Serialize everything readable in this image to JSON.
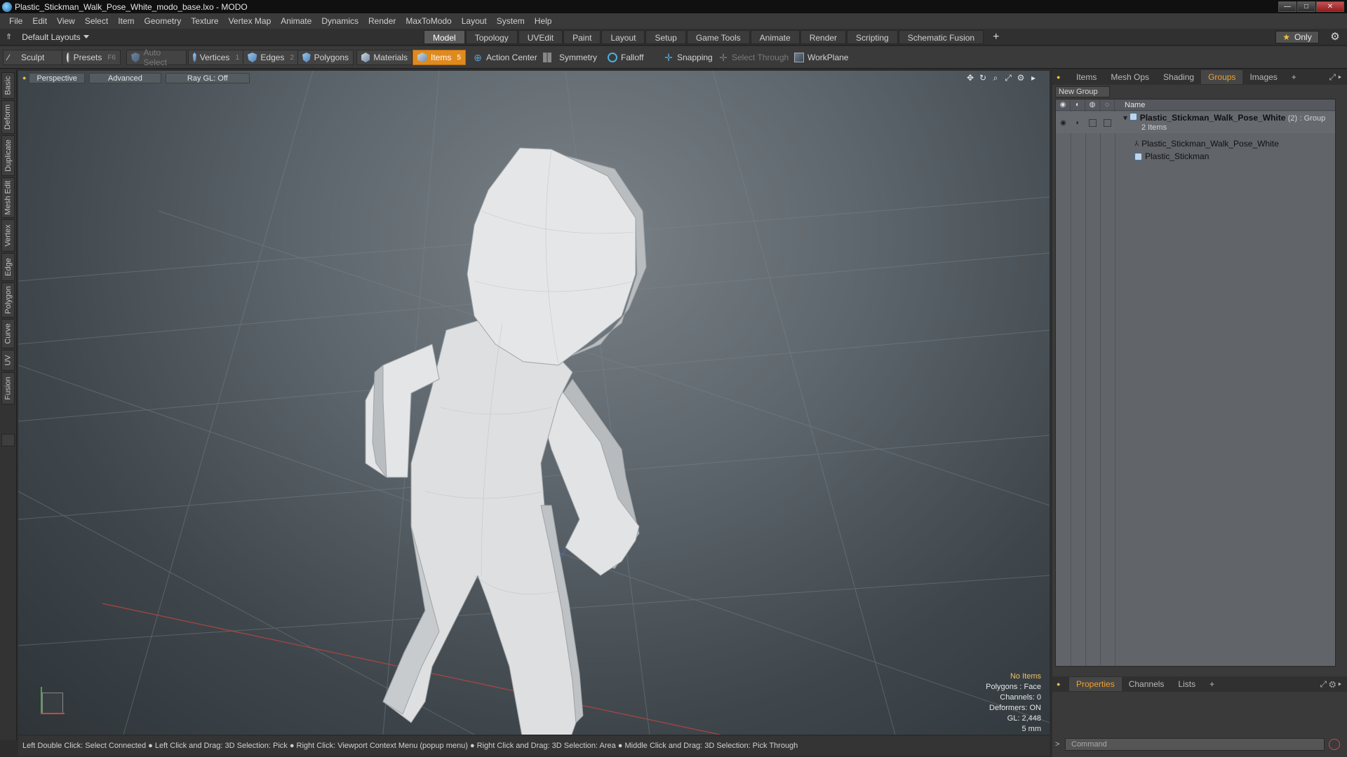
{
  "window": {
    "title": "Plastic_Stickman_Walk_Pose_White_modo_base.lxo - MODO",
    "controls": {
      "minimize": "—",
      "maximize": "□",
      "close": "✕"
    }
  },
  "menu": [
    "File",
    "Edit",
    "View",
    "Select",
    "Item",
    "Geometry",
    "Texture",
    "Vertex Map",
    "Animate",
    "Dynamics",
    "Render",
    "MaxToModo",
    "Layout",
    "System",
    "Help"
  ],
  "layoutbar": {
    "layout": "Default Layouts",
    "tabs": [
      "Model",
      "Topology",
      "UVEdit",
      "Paint",
      "Layout",
      "Setup",
      "Game Tools",
      "Animate",
      "Render",
      "Scripting",
      "Schematic Fusion"
    ],
    "active_tab": "Model",
    "add": "+",
    "only_label": "Only"
  },
  "toolbar": {
    "sculpt": "Sculpt",
    "presets": "Presets",
    "presets_key": "F6",
    "auto_select": "Auto Select",
    "vertices": "Vertices",
    "vertices_count": "1",
    "edges": "Edges",
    "edges_count": "2",
    "polygons": "Polygons",
    "materials": "Materials",
    "items": "Items",
    "items_count": "5",
    "action_center": "Action Center",
    "symmetry": "Symmetry",
    "falloff": "Falloff",
    "snapping": "Snapping",
    "select_through": "Select Through",
    "workplane": "WorkPlane"
  },
  "left_tabs": [
    "Basic",
    "Deform",
    "Duplicate",
    "Mesh Edit",
    "Vertex",
    "Edge",
    "Polygon",
    "Curve",
    "UV",
    "Fusion"
  ],
  "viewport": {
    "view": "Perspective",
    "mode": "Advanced",
    "raygl": "Ray GL: Off",
    "stats": {
      "items": "No Items",
      "polygons": "Polygons : Face",
      "channels": "Channels: 0",
      "deformers": "Deformers: ON",
      "gl": "GL: 2,448",
      "scale": "5 mm"
    }
  },
  "hint": "Left Double Click: Select Connected ● Left Click and Drag: 3D Selection: Pick ● Right Click: Viewport Context Menu (popup menu) ● Right Click and Drag: 3D Selection: Area ● Middle Click and Drag: 3D Selection: Pick Through",
  "panel": {
    "tabs": [
      "Items",
      "Mesh Ops",
      "Shading",
      "Groups",
      "Images"
    ],
    "active_tab": "Groups",
    "new_group": "New Group",
    "column_name": "Name",
    "group": {
      "name": "Plastic_Stickman_Walk_Pose_White",
      "count": "(2)",
      "type": ": Group",
      "subtitle": "2 Items",
      "children": [
        "Plastic_Stickman_Walk_Pose_White",
        "Plastic_Stickman"
      ]
    },
    "bottom_tabs": [
      "Properties",
      "Channels",
      "Lists"
    ],
    "bottom_active": "Properties",
    "command_placeholder": "Command"
  },
  "colors": {
    "accent": "#e08a1e",
    "active_tab_text": "#f0a030"
  }
}
